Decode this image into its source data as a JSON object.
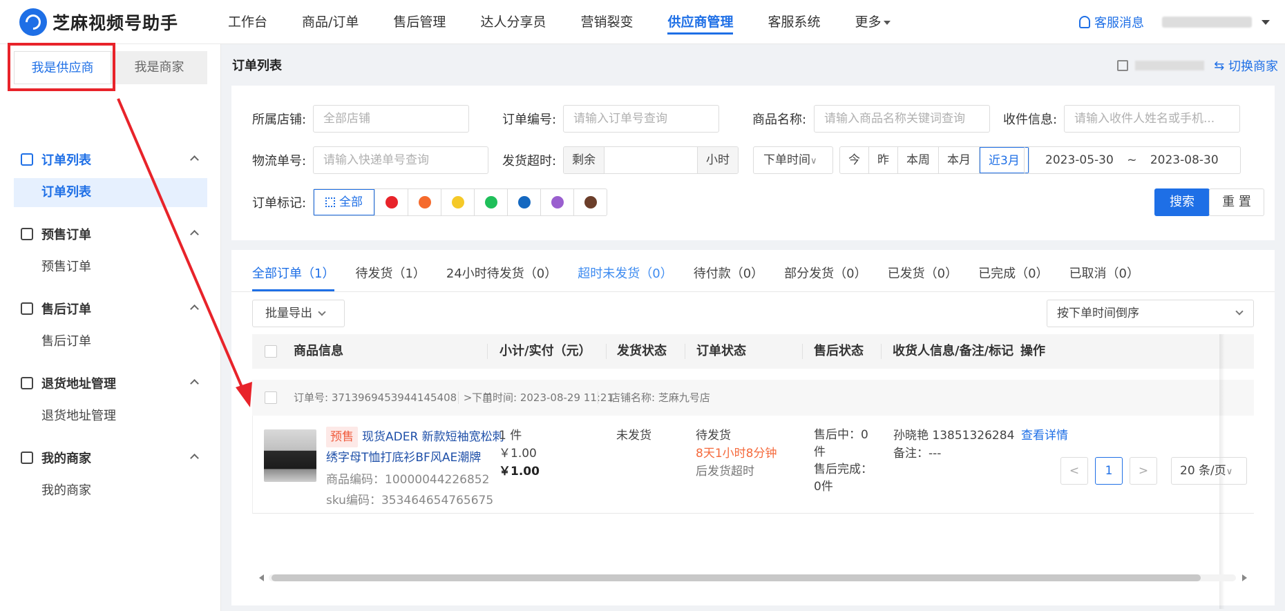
{
  "app": {
    "title": "芝麻视频号助手"
  },
  "nav": {
    "items": [
      "工作台",
      "商品/订单",
      "售后管理",
      "达人分享员",
      "营销裂变",
      "供应商管理",
      "客服系统",
      "更多"
    ],
    "active_index": 5,
    "service_msg": "客服消息"
  },
  "sidebar": {
    "role_tabs": [
      "我是供应商",
      "我是商家"
    ],
    "groups": [
      {
        "label": "订单列表",
        "sub": "订单列表"
      },
      {
        "label": "预售订单",
        "sub": "预售订单"
      },
      {
        "label": "售后订单",
        "sub": "售后订单"
      },
      {
        "label": "退货地址管理",
        "sub": "退货地址管理"
      },
      {
        "label": "我的商家",
        "sub": "我的商家"
      }
    ]
  },
  "header": {
    "title": "订单列表",
    "switch_label": "切换商家"
  },
  "filters": {
    "shop_label": "所属店铺:",
    "shop_placeholder": "全部店铺",
    "order_no_label": "订单编号:",
    "order_no_placeholder": "请输入订单号查询",
    "product_label": "商品名称:",
    "product_placeholder": "请输入商品名称关键词查询",
    "receiver_label": "收件信息:",
    "receiver_placeholder": "请输入收件人姓名或手机...",
    "logistics_label": "物流单号:",
    "logistics_placeholder": "请输入快递单号查询",
    "overtime_label": "发货超时:",
    "overtime_prefix": "剩余",
    "overtime_suffix": "小时",
    "time_type": "下单时间",
    "quick_ranges": [
      "今",
      "昨",
      "本周",
      "本月",
      "近3月"
    ],
    "date_start": "2023-05-30",
    "date_sep": "~",
    "date_end": "2023-08-30",
    "mark_label": "订单标记:",
    "mark_all": "全部",
    "mark_colors": [
      "#e8232a",
      "#f56a2c",
      "#f5c928",
      "#1fbf5a",
      "#1468c0",
      "#9a5fcf",
      "#6b3e2a"
    ],
    "search_btn": "搜索",
    "reset_btn": "重 置"
  },
  "tabs": [
    "全部订单（1）",
    "待发货（1）",
    "24小时待发货（0）",
    "超时未发货（0）",
    "待付款（0）",
    "部分发货（0）",
    "已发货（0）",
    "已完成（0）",
    "已取消（0）"
  ],
  "toolbar": {
    "bulk_export": "批量导出",
    "sort": "按下单时间倒序"
  },
  "table": {
    "headers": [
      "商品信息",
      "小计/实付（元）",
      "发货状态",
      "订单状态",
      "售后状态",
      "收货人信息/备注/标记",
      "操作"
    ]
  },
  "order": {
    "no_label": "订单号:",
    "no": "3713969453944145408",
    "time_label": "下单时间:",
    "time": "2023-08-29 11:21",
    "shop_label": "店铺名称:",
    "shop": "芝麻九号店",
    "tag": "预售",
    "name": "现货ADER 新款短袖宽松刺绣字母T恤打底衫BF风AE潮牌",
    "product_code": "商品编码：10000044226852",
    "sku_code": "sku编码：353464654765675",
    "qty": "1 件",
    "subtotal": "￥1.00",
    "paid": "￥1.00",
    "ship_status": "未发货",
    "order_status": "待发货",
    "countdown": "8天1小时8分钟",
    "countdown_suffix": "后发货超时",
    "after_sale_1": "售后中：0",
    "after_sale_1b": "件",
    "after_sale_2": "售后完成：",
    "after_sale_2b": "0件",
    "receiver": "孙晓艳 13851326284",
    "remark": "备注：---",
    "action": "查看详情"
  },
  "pager": {
    "prev": "<",
    "current": "1",
    "next": ">",
    "size": "20 条/页"
  }
}
